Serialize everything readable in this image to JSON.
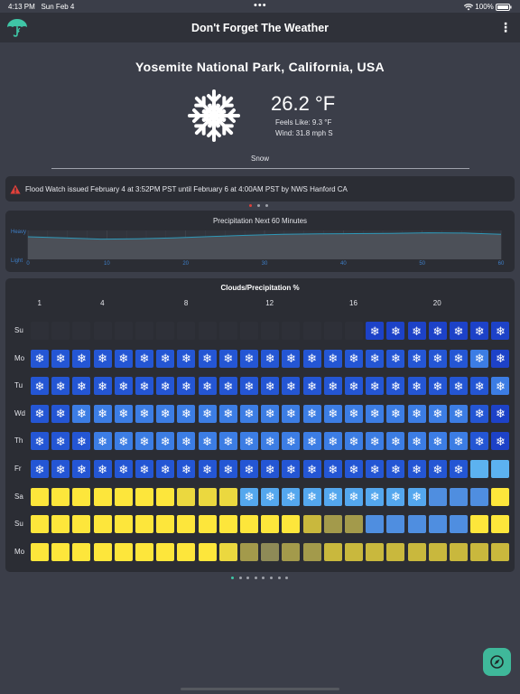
{
  "status": {
    "time": "4:13 PM",
    "date": "Sun Feb 4",
    "battery": "100%"
  },
  "app": {
    "title": "Don't Forget The Weather",
    "menu": "⋮"
  },
  "location": "Yosemite National Park, California, USA",
  "current": {
    "temperature": "26.2 °F",
    "feels_like": "Feels Like: 9.3 °F",
    "wind": "Wind: 31.8 mph S",
    "condition": "Snow"
  },
  "alert": {
    "text": "Flood Watch issued February 4 at 3:52PM PST until February 6 at 4:00AM PST by NWS Hanford CA",
    "color": "#e0403a"
  },
  "precipitation": {
    "title": "Precipitation Next 60 Minutes",
    "y_labels": [
      "Heavy",
      "Light"
    ],
    "x_ticks": [
      "0",
      "10",
      "20",
      "30",
      "40",
      "50",
      "60"
    ],
    "values": [
      0.78,
      0.74,
      0.7,
      0.71,
      0.74,
      0.79,
      0.83,
      0.87,
      0.88,
      0.89,
      0.9,
      0.92,
      0.91,
      0.87
    ],
    "line_color": "#2e98b8"
  },
  "clouds_grid": {
    "title": "Clouds/Precipitation %",
    "hour_labels": [
      {
        "label": "1",
        "col": 0
      },
      {
        "label": "4",
        "col": 3
      },
      {
        "label": "8",
        "col": 7
      },
      {
        "label": "12",
        "col": 11
      },
      {
        "label": "16",
        "col": 15
      },
      {
        "label": "20",
        "col": 19
      }
    ],
    "colors": {
      "e": "#2e3038",
      "S": "#1d42c8",
      "s": "#2456d4",
      "L": "#3c7de4",
      "l": "#54a7ee",
      "B": "#4f8ee0",
      "b": "#5cb2f0",
      "Y": "#fde63b",
      "y": "#ebd83f",
      "o": "#c9b83d",
      "O": "#a39a4b",
      "g": "#8e8a57"
    },
    "rows": [
      {
        "day": "Su",
        "cells": "eeeeeeeeeeeeeeeeSSSSSSS"
      },
      {
        "day": "Mo",
        "cells": "sssssssssssssssssssssLS"
      },
      {
        "day": "Tu",
        "cells": "ssssssssssssssssssssssL"
      },
      {
        "day": "Wd",
        "cells": "ssLLLLLLLLLLLLLLLLLLLsS"
      },
      {
        "day": "Th",
        "cells": "sssLLLLLLLLLLLLLLLLLLsS"
      },
      {
        "day": "Fr",
        "cells": "sssssssssssssssssssssbb"
      },
      {
        "day": "Sa",
        "cells": "YYYYYYYyyylllllllllBBBYY"
      },
      {
        "day": "Su",
        "cells": "YYYYYYYYYYYYYoOOBBBBBYY"
      },
      {
        "day": "Mo",
        "cells": "YYYYYYYYYyOgOOoooooooooo"
      }
    ],
    "snow_codes": "SsLl"
  },
  "pager": {
    "count": 8,
    "active": 0,
    "active_color": "#3fc6a6"
  },
  "icons": [
    "umbrella-logo-icon",
    "more-vertical-icon",
    "snowflake-icon",
    "warning-triangle-icon",
    "compass-icon",
    "wifi-icon",
    "battery-icon"
  ]
}
